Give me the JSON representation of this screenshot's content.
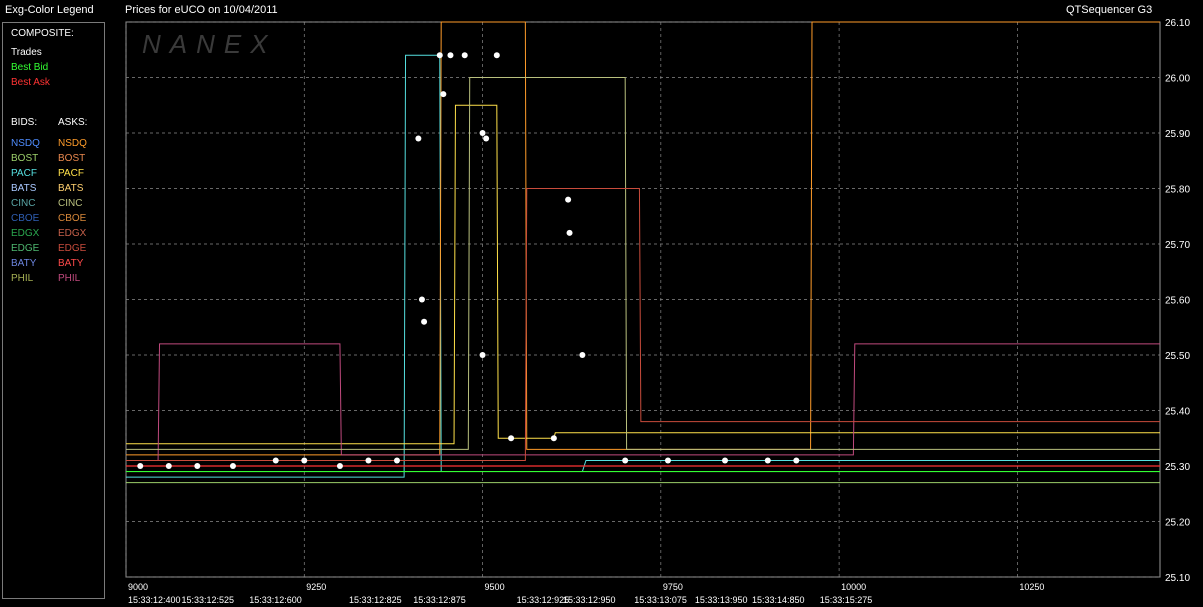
{
  "window": {
    "legend_title": "Exg-Color Legend",
    "chart_title": "Prices for  eUCO  on  10/04/2011",
    "app_name": "QTSequencer G3"
  },
  "legend": {
    "composite_label": "COMPOSITE:",
    "composite": [
      {
        "name": "Trades",
        "color": "#ffffff"
      },
      {
        "name": "Best Bid",
        "color": "#33ff33"
      },
      {
        "name": "Best Ask",
        "color": "#ff3333"
      }
    ],
    "bids_label": "BIDS:",
    "asks_label": "ASKS:",
    "exchanges": [
      {
        "name": "NSDQ",
        "bid_color": "#4f8dff",
        "ask_color": "#ff9c2a"
      },
      {
        "name": "BOST",
        "bid_color": "#9ccf6a",
        "ask_color": "#e9884e"
      },
      {
        "name": "PACF",
        "bid_color": "#55e0e0",
        "ask_color": "#ffe14a"
      },
      {
        "name": "BATS",
        "bid_color": "#a9c8ff",
        "ask_color": "#ffd070"
      },
      {
        "name": "CINC",
        "bid_color": "#5aa6a6",
        "ask_color": "#b9c07e"
      },
      {
        "name": "CBOE",
        "bid_color": "#2f5fb4",
        "ask_color": "#d9893a"
      },
      {
        "name": "EDGX",
        "bid_color": "#2aa84f",
        "ask_color": "#c6604a"
      },
      {
        "name": "EDGE",
        "bid_color": "#4fb870",
        "ask_color": "#c94c3c"
      },
      {
        "name": "BATY",
        "bid_color": "#6d86e0",
        "ask_color": "#ff4a4a"
      },
      {
        "name": "PHIL",
        "bid_color": "#a6b054",
        "ask_color": "#c04a7e"
      }
    ]
  },
  "chart_data": {
    "type": "line",
    "title": "Prices for  eUCO  on  10/04/2011",
    "watermark": "NANEX",
    "grid": true,
    "ylim": [
      25.1,
      26.1
    ],
    "y_ticks": [
      "25.10",
      "25.20",
      "25.30",
      "25.40",
      "25.50",
      "25.60",
      "25.70",
      "25.80",
      "25.90",
      "26.00",
      "26.10"
    ],
    "xlim": [
      9000,
      10450
    ],
    "x_seq_ticks": [
      {
        "value": 9000,
        "label": "9000"
      },
      {
        "value": 9250,
        "label": "9250"
      },
      {
        "value": 9500,
        "label": "9500"
      },
      {
        "value": 9750,
        "label": "9750"
      },
      {
        "value": 10000,
        "label": "10000"
      },
      {
        "value": 10250,
        "label": "10250"
      }
    ],
    "x_time_ticks": [
      {
        "value": 9000,
        "label": "15:33:12:400"
      },
      {
        "value": 9075,
        "label": "15:33:12:525"
      },
      {
        "value": 9170,
        "label": "15:33:12:600"
      },
      {
        "value": 9310,
        "label": "15:33:12:825"
      },
      {
        "value": 9400,
        "label": "15:33:12:875"
      },
      {
        "value": 9545,
        "label": "15:33:12:925"
      },
      {
        "value": 9610,
        "label": "15:33:12:950"
      },
      {
        "value": 9710,
        "label": "15:33:13:075"
      },
      {
        "value": 9795,
        "label": "15:33:13:950"
      },
      {
        "value": 9875,
        "label": "15:33:14:850"
      },
      {
        "value": 9970,
        "label": "15:33:15:275"
      }
    ],
    "best_bid": 25.29,
    "best_ask": 25.3,
    "series": [
      {
        "name": "PACF",
        "side": "bid",
        "color": "#55e0e0",
        "x": [
          9000,
          9390,
          9392,
          9440,
          9442,
          9640,
          9645,
          10450
        ],
        "y": [
          25.28,
          25.28,
          26.04,
          26.04,
          25.29,
          25.29,
          25.31,
          25.31
        ]
      },
      {
        "name": "NSDQ",
        "side": "ask",
        "color": "#ff9c2a",
        "x": [
          9000,
          9440,
          9442,
          9560,
          9562,
          9960,
          9962,
          10450
        ],
        "y": [
          25.32,
          25.32,
          26.1,
          26.1,
          25.33,
          25.33,
          26.1,
          26.1
        ]
      },
      {
        "name": "PACF",
        "side": "ask",
        "color": "#ffe14a",
        "x": [
          9000,
          9460,
          9462,
          9520,
          9522,
          9600,
          9602,
          10450
        ],
        "y": [
          25.34,
          25.34,
          25.95,
          25.95,
          25.35,
          25.35,
          25.36,
          25.36
        ]
      },
      {
        "name": "PHIL",
        "side": "ask",
        "color": "#c04a7e",
        "x": [
          9000,
          9045,
          9047,
          9300,
          9302,
          10020,
          10022,
          10450
        ],
        "y": [
          25.31,
          25.31,
          25.52,
          25.52,
          25.32,
          25.32,
          25.52,
          25.52
        ]
      },
      {
        "name": "CINC",
        "side": "ask",
        "color": "#b9c07e",
        "x": [
          9000,
          9480,
          9482,
          9700,
          9702,
          10450
        ],
        "y": [
          25.33,
          25.33,
          26.0,
          26.0,
          25.33,
          25.33
        ]
      },
      {
        "name": "EDGE",
        "side": "ask",
        "color": "#c94c3c",
        "x": [
          9000,
          9560,
          9562,
          9720,
          9722,
          10450
        ],
        "y": [
          25.31,
          25.31,
          25.8,
          25.8,
          25.38,
          25.38
        ]
      },
      {
        "name": "BOST",
        "side": "bid",
        "color": "#9ccf6a",
        "x": [
          9000,
          10450
        ],
        "y": [
          25.27,
          25.27
        ]
      }
    ],
    "trades": [
      {
        "x": 9020,
        "y": 25.3
      },
      {
        "x": 9060,
        "y": 25.3
      },
      {
        "x": 9100,
        "y": 25.3
      },
      {
        "x": 9150,
        "y": 25.3
      },
      {
        "x": 9210,
        "y": 25.31
      },
      {
        "x": 9250,
        "y": 25.31
      },
      {
        "x": 9300,
        "y": 25.3
      },
      {
        "x": 9340,
        "y": 25.31
      },
      {
        "x": 9380,
        "y": 25.31
      },
      {
        "x": 9410,
        "y": 25.89
      },
      {
        "x": 9415,
        "y": 25.6
      },
      {
        "x": 9418,
        "y": 25.56
      },
      {
        "x": 9440,
        "y": 26.04
      },
      {
        "x": 9455,
        "y": 26.04
      },
      {
        "x": 9475,
        "y": 26.04
      },
      {
        "x": 9445,
        "y": 25.97
      },
      {
        "x": 9500,
        "y": 25.9
      },
      {
        "x": 9505,
        "y": 25.89
      },
      {
        "x": 9500,
        "y": 25.5
      },
      {
        "x": 9520,
        "y": 26.04
      },
      {
        "x": 9540,
        "y": 25.35
      },
      {
        "x": 9600,
        "y": 25.35
      },
      {
        "x": 9620,
        "y": 25.78
      },
      {
        "x": 9622,
        "y": 25.72
      },
      {
        "x": 9640,
        "y": 25.5
      },
      {
        "x": 9700,
        "y": 25.31
      },
      {
        "x": 9760,
        "y": 25.31
      },
      {
        "x": 9840,
        "y": 25.31
      },
      {
        "x": 9900,
        "y": 25.31
      },
      {
        "x": 9940,
        "y": 25.31
      }
    ]
  }
}
